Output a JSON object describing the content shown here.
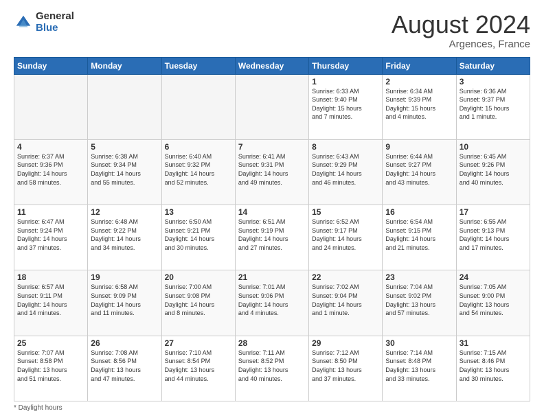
{
  "logo": {
    "general": "General",
    "blue": "Blue"
  },
  "header": {
    "month": "August 2024",
    "location": "Argences, France"
  },
  "days_of_week": [
    "Sunday",
    "Monday",
    "Tuesday",
    "Wednesday",
    "Thursday",
    "Friday",
    "Saturday"
  ],
  "weeks": [
    [
      {
        "day": "",
        "info": ""
      },
      {
        "day": "",
        "info": ""
      },
      {
        "day": "",
        "info": ""
      },
      {
        "day": "",
        "info": ""
      },
      {
        "day": "1",
        "info": "Sunrise: 6:33 AM\nSunset: 9:40 PM\nDaylight: 15 hours\nand 7 minutes."
      },
      {
        "day": "2",
        "info": "Sunrise: 6:34 AM\nSunset: 9:39 PM\nDaylight: 15 hours\nand 4 minutes."
      },
      {
        "day": "3",
        "info": "Sunrise: 6:36 AM\nSunset: 9:37 PM\nDaylight: 15 hours\nand 1 minute."
      }
    ],
    [
      {
        "day": "4",
        "info": "Sunrise: 6:37 AM\nSunset: 9:36 PM\nDaylight: 14 hours\nand 58 minutes."
      },
      {
        "day": "5",
        "info": "Sunrise: 6:38 AM\nSunset: 9:34 PM\nDaylight: 14 hours\nand 55 minutes."
      },
      {
        "day": "6",
        "info": "Sunrise: 6:40 AM\nSunset: 9:32 PM\nDaylight: 14 hours\nand 52 minutes."
      },
      {
        "day": "7",
        "info": "Sunrise: 6:41 AM\nSunset: 9:31 PM\nDaylight: 14 hours\nand 49 minutes."
      },
      {
        "day": "8",
        "info": "Sunrise: 6:43 AM\nSunset: 9:29 PM\nDaylight: 14 hours\nand 46 minutes."
      },
      {
        "day": "9",
        "info": "Sunrise: 6:44 AM\nSunset: 9:27 PM\nDaylight: 14 hours\nand 43 minutes."
      },
      {
        "day": "10",
        "info": "Sunrise: 6:45 AM\nSunset: 9:26 PM\nDaylight: 14 hours\nand 40 minutes."
      }
    ],
    [
      {
        "day": "11",
        "info": "Sunrise: 6:47 AM\nSunset: 9:24 PM\nDaylight: 14 hours\nand 37 minutes."
      },
      {
        "day": "12",
        "info": "Sunrise: 6:48 AM\nSunset: 9:22 PM\nDaylight: 14 hours\nand 34 minutes."
      },
      {
        "day": "13",
        "info": "Sunrise: 6:50 AM\nSunset: 9:21 PM\nDaylight: 14 hours\nand 30 minutes."
      },
      {
        "day": "14",
        "info": "Sunrise: 6:51 AM\nSunset: 9:19 PM\nDaylight: 14 hours\nand 27 minutes."
      },
      {
        "day": "15",
        "info": "Sunrise: 6:52 AM\nSunset: 9:17 PM\nDaylight: 14 hours\nand 24 minutes."
      },
      {
        "day": "16",
        "info": "Sunrise: 6:54 AM\nSunset: 9:15 PM\nDaylight: 14 hours\nand 21 minutes."
      },
      {
        "day": "17",
        "info": "Sunrise: 6:55 AM\nSunset: 9:13 PM\nDaylight: 14 hours\nand 17 minutes."
      }
    ],
    [
      {
        "day": "18",
        "info": "Sunrise: 6:57 AM\nSunset: 9:11 PM\nDaylight: 14 hours\nand 14 minutes."
      },
      {
        "day": "19",
        "info": "Sunrise: 6:58 AM\nSunset: 9:09 PM\nDaylight: 14 hours\nand 11 minutes."
      },
      {
        "day": "20",
        "info": "Sunrise: 7:00 AM\nSunset: 9:08 PM\nDaylight: 14 hours\nand 8 minutes."
      },
      {
        "day": "21",
        "info": "Sunrise: 7:01 AM\nSunset: 9:06 PM\nDaylight: 14 hours\nand 4 minutes."
      },
      {
        "day": "22",
        "info": "Sunrise: 7:02 AM\nSunset: 9:04 PM\nDaylight: 14 hours\nand 1 minute."
      },
      {
        "day": "23",
        "info": "Sunrise: 7:04 AM\nSunset: 9:02 PM\nDaylight: 13 hours\nand 57 minutes."
      },
      {
        "day": "24",
        "info": "Sunrise: 7:05 AM\nSunset: 9:00 PM\nDaylight: 13 hours\nand 54 minutes."
      }
    ],
    [
      {
        "day": "25",
        "info": "Sunrise: 7:07 AM\nSunset: 8:58 PM\nDaylight: 13 hours\nand 51 minutes."
      },
      {
        "day": "26",
        "info": "Sunrise: 7:08 AM\nSunset: 8:56 PM\nDaylight: 13 hours\nand 47 minutes."
      },
      {
        "day": "27",
        "info": "Sunrise: 7:10 AM\nSunset: 8:54 PM\nDaylight: 13 hours\nand 44 minutes."
      },
      {
        "day": "28",
        "info": "Sunrise: 7:11 AM\nSunset: 8:52 PM\nDaylight: 13 hours\nand 40 minutes."
      },
      {
        "day": "29",
        "info": "Sunrise: 7:12 AM\nSunset: 8:50 PM\nDaylight: 13 hours\nand 37 minutes."
      },
      {
        "day": "30",
        "info": "Sunrise: 7:14 AM\nSunset: 8:48 PM\nDaylight: 13 hours\nand 33 minutes."
      },
      {
        "day": "31",
        "info": "Sunrise: 7:15 AM\nSunset: 8:46 PM\nDaylight: 13 hours\nand 30 minutes."
      }
    ]
  ],
  "footer": {
    "note": "Daylight hours"
  }
}
